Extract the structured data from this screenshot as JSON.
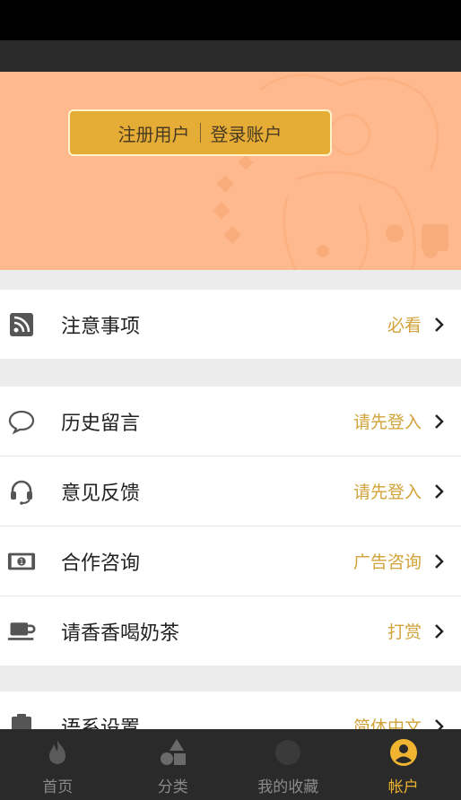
{
  "banner": {
    "register_label": "注册用户",
    "login_label": "登录账户"
  },
  "group1": [
    {
      "label": "注意事项",
      "value": "必看",
      "icon": "rss-icon"
    }
  ],
  "group2": [
    {
      "label": "历史留言",
      "value": "请先登入",
      "icon": "chat-bubble-icon"
    },
    {
      "label": "意见反馈",
      "value": "请先登入",
      "icon": "headset-icon"
    },
    {
      "label": "合作咨询",
      "value": "广告咨询",
      "icon": "money-icon"
    },
    {
      "label": "请香香喝奶茶",
      "value": "打赏",
      "icon": "coffee-cup-icon"
    }
  ],
  "group3": [
    {
      "label": "语系设置",
      "value": "简体中文",
      "icon": "clipboard-icon"
    }
  ],
  "tabs": [
    {
      "label": "首页",
      "icon": "flame-icon"
    },
    {
      "label": "分类",
      "icon": "shapes-icon"
    },
    {
      "label": "我的收藏",
      "icon": "favorite-icon"
    },
    {
      "label": "帐户",
      "icon": "user-circle-icon"
    }
  ],
  "colors": {
    "accent": "#e6ad36",
    "value_text": "#d2a33a",
    "banner_bg": "#ffb98f",
    "tab_active": "#f0b431"
  }
}
